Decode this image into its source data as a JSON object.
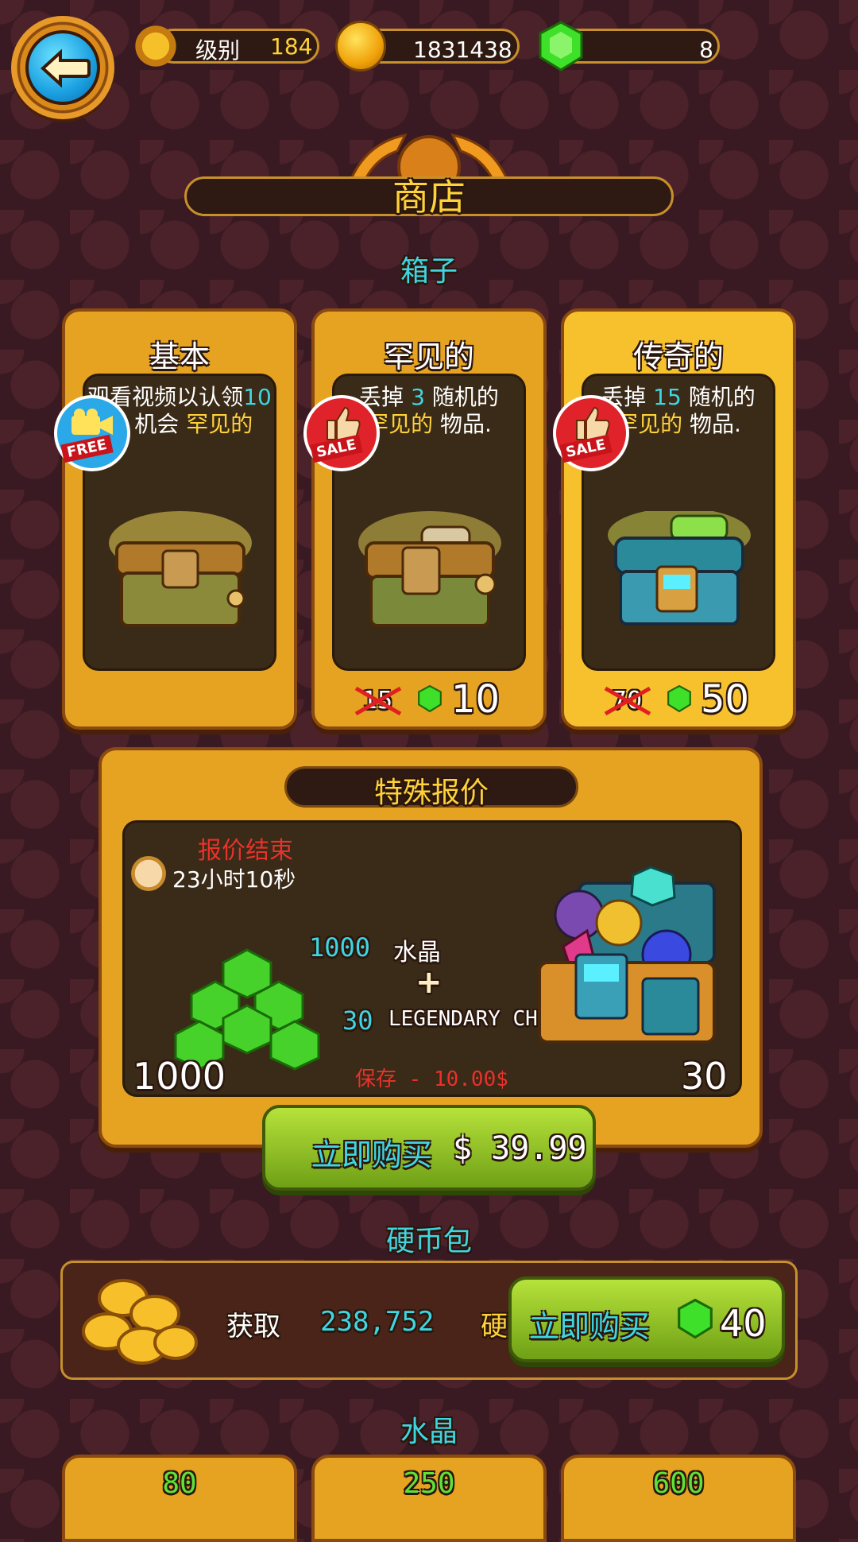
{
  "topbar": {
    "level_label": "级别",
    "level_value": "184",
    "coins_value": "1831438",
    "gems_value": "8"
  },
  "title": "商店",
  "chests_section": {
    "label": "箱子",
    "cards": [
      {
        "title": "基本",
        "desc_line1": "观看视频以认领",
        "desc_pct": "10",
        "desc_line2_a": "%",
        "desc_line2_b": "机会",
        "desc_line2_c": "罕见的",
        "badge": "FREE"
      },
      {
        "title": "罕见的",
        "desc_a": "丢掉",
        "desc_n": "3",
        "desc_b": "随机的",
        "desc_c": "罕见的",
        "desc_d": "物品.",
        "badge": "SALE",
        "old_price": "15",
        "new_price": "10"
      },
      {
        "title": "传奇的",
        "desc_a": "丢掉",
        "desc_n": "15",
        "desc_b": "随机的",
        "desc_c": "罕见的",
        "desc_d": "物品.",
        "badge": "SALE",
        "old_price": "70",
        "new_price": "50"
      }
    ]
  },
  "special_offer": {
    "title": "特殊报价",
    "ends_label": "报价结束",
    "timer": "23小时10秒",
    "crystal_amount": "1000",
    "crystal_label": "水晶",
    "plus": "+",
    "chest_amount": "30",
    "chest_label": "LEGENDARY CHEST",
    "left_count": "1000",
    "right_count": "30",
    "save_label": "保存 - 10.00$",
    "buy_label": "立即购买",
    "price": "$ 39.99"
  },
  "coin_section": {
    "label": "硬币包",
    "get_label": "获取",
    "amount": "238,752",
    "unit": "硬",
    "buy_label": "立即购买",
    "gem_price": "40"
  },
  "crystal_section": {
    "label": "水晶",
    "packs": [
      "80",
      "250",
      "600"
    ]
  },
  "colors": {
    "accent_cyan": "#3fd6e2",
    "accent_yellow": "#ffd23a",
    "sale_red": "#e0232a",
    "button_green": "#8cc425"
  }
}
